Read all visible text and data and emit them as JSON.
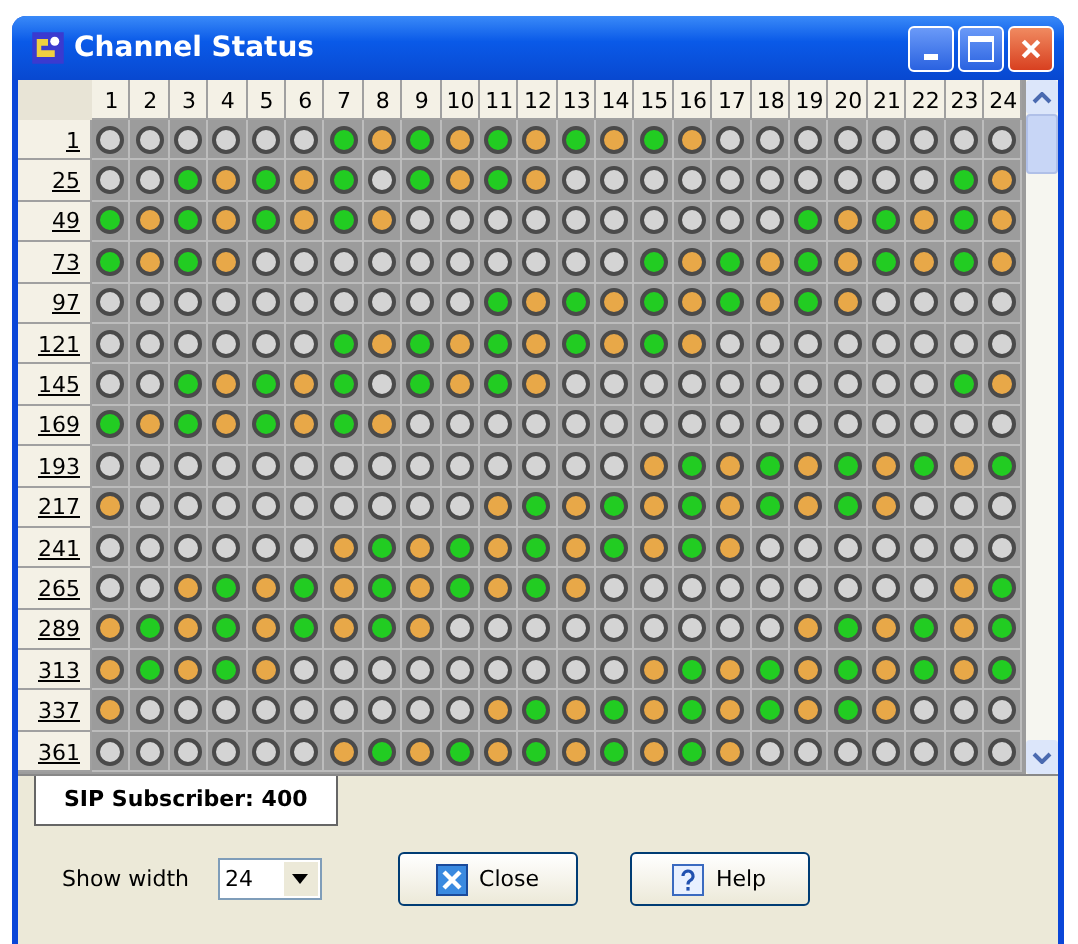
{
  "window": {
    "title": "Channel Status"
  },
  "columns": [
    "1",
    "2",
    "3",
    "4",
    "5",
    "6",
    "7",
    "8",
    "9",
    "10",
    "11",
    "12",
    "13",
    "14",
    "15",
    "16",
    "17",
    "18",
    "19",
    "20",
    "21",
    "22",
    "23",
    "24"
  ],
  "rows": [
    {
      "label": "1",
      "cells": [
        {
          "color": "#d4d4d4"
        },
        {
          "color": "#d4d4d4"
        },
        {
          "color": "#d4d4d4"
        },
        {
          "color": "#d4d4d4"
        },
        {
          "color": "#d4d4d4"
        },
        {
          "color": "#d4d4d4"
        },
        {
          "color": "#22cc22"
        },
        {
          "color": "#e8a848"
        },
        {
          "color": "#22cc22"
        },
        {
          "color": "#e8a848"
        },
        {
          "color": "#22cc22"
        },
        {
          "color": "#e8a848"
        },
        {
          "color": "#22cc22"
        },
        {
          "color": "#e8a848"
        },
        {
          "color": "#22cc22"
        },
        {
          "color": "#e8a848"
        },
        {
          "color": "#d4d4d4"
        },
        {
          "color": "#d4d4d4"
        },
        {
          "color": "#d4d4d4"
        },
        {
          "color": "#d4d4d4"
        },
        {
          "color": "#d4d4d4"
        },
        {
          "color": "#d4d4d4"
        },
        {
          "color": "#d4d4d4"
        },
        {
          "color": "#d4d4d4"
        }
      ]
    },
    {
      "label": "25",
      "cells": [
        {
          "color": "#d4d4d4"
        },
        {
          "color": "#d4d4d4"
        },
        {
          "color": "#22cc22"
        },
        {
          "color": "#e8a848"
        },
        {
          "color": "#22cc22"
        },
        {
          "color": "#e8a848"
        },
        {
          "color": "#22cc22"
        },
        {
          "color": "#d4d4d4"
        },
        {
          "color": "#22cc22"
        },
        {
          "color": "#e8a848"
        },
        {
          "color": "#22cc22"
        },
        {
          "color": "#e8a848"
        },
        {
          "color": "#d4d4d4"
        },
        {
          "color": "#d4d4d4"
        },
        {
          "color": "#d4d4d4"
        },
        {
          "color": "#d4d4d4"
        },
        {
          "color": "#d4d4d4"
        },
        {
          "color": "#d4d4d4"
        },
        {
          "color": "#d4d4d4"
        },
        {
          "color": "#d4d4d4"
        },
        {
          "color": "#d4d4d4"
        },
        {
          "color": "#d4d4d4"
        },
        {
          "color": "#22cc22"
        },
        {
          "color": "#e8a848"
        }
      ]
    },
    {
      "label": "49",
      "cells": [
        {
          "color": "#22cc22"
        },
        {
          "color": "#e8a848"
        },
        {
          "color": "#22cc22"
        },
        {
          "color": "#e8a848"
        },
        {
          "color": "#22cc22"
        },
        {
          "color": "#e8a848"
        },
        {
          "color": "#22cc22"
        },
        {
          "color": "#e8a848"
        },
        {
          "color": "#d4d4d4"
        },
        {
          "color": "#d4d4d4"
        },
        {
          "color": "#d4d4d4"
        },
        {
          "color": "#d4d4d4"
        },
        {
          "color": "#d4d4d4"
        },
        {
          "color": "#d4d4d4"
        },
        {
          "color": "#d4d4d4"
        },
        {
          "color": "#d4d4d4"
        },
        {
          "color": "#d4d4d4"
        },
        {
          "color": "#d4d4d4"
        },
        {
          "color": "#22cc22"
        },
        {
          "color": "#e8a848"
        },
        {
          "color": "#22cc22"
        },
        {
          "color": "#e8a848"
        },
        {
          "color": "#22cc22"
        },
        {
          "color": "#e8a848"
        }
      ]
    },
    {
      "label": "73",
      "cells": [
        {
          "color": "#22cc22"
        },
        {
          "color": "#e8a848"
        },
        {
          "color": "#22cc22"
        },
        {
          "color": "#e8a848"
        },
        {
          "color": "#d4d4d4"
        },
        {
          "color": "#d4d4d4"
        },
        {
          "color": "#d4d4d4"
        },
        {
          "color": "#d4d4d4"
        },
        {
          "color": "#d4d4d4"
        },
        {
          "color": "#d4d4d4"
        },
        {
          "color": "#d4d4d4"
        },
        {
          "color": "#d4d4d4"
        },
        {
          "color": "#d4d4d4"
        },
        {
          "color": "#d4d4d4"
        },
        {
          "color": "#22cc22"
        },
        {
          "color": "#e8a848"
        },
        {
          "color": "#22cc22"
        },
        {
          "color": "#e8a848"
        },
        {
          "color": "#22cc22"
        },
        {
          "color": "#e8a848"
        },
        {
          "color": "#22cc22"
        },
        {
          "color": "#e8a848"
        },
        {
          "color": "#22cc22"
        },
        {
          "color": "#e8a848"
        }
      ]
    },
    {
      "label": "97",
      "cells": [
        {
          "color": "#d4d4d4"
        },
        {
          "color": "#d4d4d4"
        },
        {
          "color": "#d4d4d4"
        },
        {
          "color": "#d4d4d4"
        },
        {
          "color": "#d4d4d4"
        },
        {
          "color": "#d4d4d4"
        },
        {
          "color": "#d4d4d4"
        },
        {
          "color": "#d4d4d4"
        },
        {
          "color": "#d4d4d4"
        },
        {
          "color": "#d4d4d4"
        },
        {
          "color": "#22cc22"
        },
        {
          "color": "#e8a848"
        },
        {
          "color": "#22cc22"
        },
        {
          "color": "#e8a848"
        },
        {
          "color": "#22cc22"
        },
        {
          "color": "#e8a848"
        },
        {
          "color": "#22cc22"
        },
        {
          "color": "#e8a848"
        },
        {
          "color": "#22cc22"
        },
        {
          "color": "#e8a848"
        },
        {
          "color": "#d4d4d4"
        },
        {
          "color": "#d4d4d4"
        },
        {
          "color": "#d4d4d4"
        },
        {
          "color": "#d4d4d4"
        }
      ]
    },
    {
      "label": "121",
      "cells": [
        {
          "color": "#d4d4d4"
        },
        {
          "color": "#d4d4d4"
        },
        {
          "color": "#d4d4d4"
        },
        {
          "color": "#d4d4d4"
        },
        {
          "color": "#d4d4d4"
        },
        {
          "color": "#d4d4d4"
        },
        {
          "color": "#22cc22"
        },
        {
          "color": "#e8a848"
        },
        {
          "color": "#22cc22"
        },
        {
          "color": "#e8a848"
        },
        {
          "color": "#22cc22"
        },
        {
          "color": "#e8a848"
        },
        {
          "color": "#22cc22"
        },
        {
          "color": "#e8a848"
        },
        {
          "color": "#22cc22"
        },
        {
          "color": "#e8a848"
        },
        {
          "color": "#d4d4d4"
        },
        {
          "color": "#d4d4d4"
        },
        {
          "color": "#d4d4d4"
        },
        {
          "color": "#d4d4d4"
        },
        {
          "color": "#d4d4d4"
        },
        {
          "color": "#d4d4d4"
        },
        {
          "color": "#d4d4d4"
        },
        {
          "color": "#d4d4d4"
        }
      ]
    },
    {
      "label": "145",
      "cells": [
        {
          "color": "#d4d4d4"
        },
        {
          "color": "#d4d4d4"
        },
        {
          "color": "#22cc22"
        },
        {
          "color": "#e8a848"
        },
        {
          "color": "#22cc22"
        },
        {
          "color": "#e8a848"
        },
        {
          "color": "#22cc22"
        },
        {
          "color": "#d4d4d4"
        },
        {
          "color": "#22cc22"
        },
        {
          "color": "#e8a848"
        },
        {
          "color": "#22cc22"
        },
        {
          "color": "#e8a848"
        },
        {
          "color": "#d4d4d4"
        },
        {
          "color": "#d4d4d4"
        },
        {
          "color": "#d4d4d4"
        },
        {
          "color": "#d4d4d4"
        },
        {
          "color": "#d4d4d4"
        },
        {
          "color": "#d4d4d4"
        },
        {
          "color": "#d4d4d4"
        },
        {
          "color": "#d4d4d4"
        },
        {
          "color": "#d4d4d4"
        },
        {
          "color": "#d4d4d4"
        },
        {
          "color": "#22cc22"
        },
        {
          "color": "#e8a848"
        }
      ]
    },
    {
      "label": "169",
      "cells": [
        {
          "color": "#22cc22"
        },
        {
          "color": "#e8a848"
        },
        {
          "color": "#22cc22"
        },
        {
          "color": "#e8a848"
        },
        {
          "color": "#22cc22"
        },
        {
          "color": "#e8a848"
        },
        {
          "color": "#22cc22"
        },
        {
          "color": "#e8a848"
        },
        {
          "color": "#d4d4d4"
        },
        {
          "color": "#d4d4d4"
        },
        {
          "color": "#d4d4d4"
        },
        {
          "color": "#d4d4d4"
        },
        {
          "color": "#d4d4d4"
        },
        {
          "color": "#d4d4d4"
        },
        {
          "color": "#d4d4d4"
        },
        {
          "color": "#d4d4d4"
        },
        {
          "color": "#d4d4d4"
        },
        {
          "color": "#d4d4d4"
        },
        {
          "color": "#d4d4d4"
        },
        {
          "color": "#d4d4d4"
        },
        {
          "color": "#d4d4d4"
        },
        {
          "color": "#d4d4d4"
        },
        {
          "color": "#d4d4d4"
        },
        {
          "color": "#d4d4d4"
        }
      ]
    },
    {
      "label": "193",
      "cells": [
        {
          "color": "#d4d4d4"
        },
        {
          "color": "#d4d4d4"
        },
        {
          "color": "#d4d4d4"
        },
        {
          "color": "#d4d4d4"
        },
        {
          "color": "#d4d4d4"
        },
        {
          "color": "#d4d4d4"
        },
        {
          "color": "#d4d4d4"
        },
        {
          "color": "#d4d4d4"
        },
        {
          "color": "#d4d4d4"
        },
        {
          "color": "#d4d4d4"
        },
        {
          "color": "#d4d4d4"
        },
        {
          "color": "#d4d4d4"
        },
        {
          "color": "#d4d4d4"
        },
        {
          "color": "#d4d4d4"
        },
        {
          "color": "#e8a848"
        },
        {
          "color": "#22cc22"
        },
        {
          "color": "#e8a848"
        },
        {
          "color": "#22cc22"
        },
        {
          "color": "#e8a848"
        },
        {
          "color": "#22cc22"
        },
        {
          "color": "#e8a848"
        },
        {
          "color": "#22cc22"
        },
        {
          "color": "#e8a848"
        },
        {
          "color": "#22cc22"
        }
      ]
    },
    {
      "label": "217",
      "cells": [
        {
          "color": "#e8a848"
        },
        {
          "color": "#d4d4d4"
        },
        {
          "color": "#d4d4d4"
        },
        {
          "color": "#d4d4d4"
        },
        {
          "color": "#d4d4d4"
        },
        {
          "color": "#d4d4d4"
        },
        {
          "color": "#d4d4d4"
        },
        {
          "color": "#d4d4d4"
        },
        {
          "color": "#d4d4d4"
        },
        {
          "color": "#d4d4d4"
        },
        {
          "color": "#e8a848"
        },
        {
          "color": "#22cc22"
        },
        {
          "color": "#e8a848"
        },
        {
          "color": "#22cc22"
        },
        {
          "color": "#e8a848"
        },
        {
          "color": "#22cc22"
        },
        {
          "color": "#e8a848"
        },
        {
          "color": "#22cc22"
        },
        {
          "color": "#e8a848"
        },
        {
          "color": "#22cc22"
        },
        {
          "color": "#e8a848"
        },
        {
          "color": "#d4d4d4"
        },
        {
          "color": "#d4d4d4"
        },
        {
          "color": "#d4d4d4"
        }
      ]
    },
    {
      "label": "241",
      "cells": [
        {
          "color": "#d4d4d4"
        },
        {
          "color": "#d4d4d4"
        },
        {
          "color": "#d4d4d4"
        },
        {
          "color": "#d4d4d4"
        },
        {
          "color": "#d4d4d4"
        },
        {
          "color": "#d4d4d4"
        },
        {
          "color": "#e8a848"
        },
        {
          "color": "#22cc22"
        },
        {
          "color": "#e8a848"
        },
        {
          "color": "#22cc22"
        },
        {
          "color": "#e8a848"
        },
        {
          "color": "#22cc22"
        },
        {
          "color": "#e8a848"
        },
        {
          "color": "#22cc22"
        },
        {
          "color": "#e8a848"
        },
        {
          "color": "#22cc22"
        },
        {
          "color": "#e8a848"
        },
        {
          "color": "#d4d4d4"
        },
        {
          "color": "#d4d4d4"
        },
        {
          "color": "#d4d4d4"
        },
        {
          "color": "#d4d4d4"
        },
        {
          "color": "#d4d4d4"
        },
        {
          "color": "#d4d4d4"
        },
        {
          "color": "#d4d4d4"
        }
      ]
    },
    {
      "label": "265",
      "cells": [
        {
          "color": "#d4d4d4"
        },
        {
          "color": "#d4d4d4"
        },
        {
          "color": "#e8a848"
        },
        {
          "color": "#22cc22"
        },
        {
          "color": "#e8a848"
        },
        {
          "color": "#22cc22"
        },
        {
          "color": "#e8a848"
        },
        {
          "color": "#22cc22"
        },
        {
          "color": "#e8a848"
        },
        {
          "color": "#22cc22"
        },
        {
          "color": "#e8a848"
        },
        {
          "color": "#22cc22"
        },
        {
          "color": "#e8a848"
        },
        {
          "color": "#d4d4d4"
        },
        {
          "color": "#d4d4d4"
        },
        {
          "color": "#d4d4d4"
        },
        {
          "color": "#d4d4d4"
        },
        {
          "color": "#d4d4d4"
        },
        {
          "color": "#d4d4d4"
        },
        {
          "color": "#d4d4d4"
        },
        {
          "color": "#d4d4d4"
        },
        {
          "color": "#d4d4d4"
        },
        {
          "color": "#e8a848"
        },
        {
          "color": "#22cc22"
        }
      ]
    },
    {
      "label": "289",
      "cells": [
        {
          "color": "#e8a848"
        },
        {
          "color": "#22cc22"
        },
        {
          "color": "#e8a848"
        },
        {
          "color": "#22cc22"
        },
        {
          "color": "#e8a848"
        },
        {
          "color": "#22cc22"
        },
        {
          "color": "#e8a848"
        },
        {
          "color": "#22cc22"
        },
        {
          "color": "#e8a848"
        },
        {
          "color": "#d4d4d4"
        },
        {
          "color": "#d4d4d4"
        },
        {
          "color": "#d4d4d4"
        },
        {
          "color": "#d4d4d4"
        },
        {
          "color": "#d4d4d4"
        },
        {
          "color": "#d4d4d4"
        },
        {
          "color": "#d4d4d4"
        },
        {
          "color": "#d4d4d4"
        },
        {
          "color": "#d4d4d4"
        },
        {
          "color": "#e8a848"
        },
        {
          "color": "#22cc22"
        },
        {
          "color": "#e8a848"
        },
        {
          "color": "#22cc22"
        },
        {
          "color": "#e8a848"
        },
        {
          "color": "#22cc22"
        }
      ]
    },
    {
      "label": "313",
      "cells": [
        {
          "color": "#e8a848"
        },
        {
          "color": "#22cc22"
        },
        {
          "color": "#e8a848"
        },
        {
          "color": "#22cc22"
        },
        {
          "color": "#e8a848"
        },
        {
          "color": "#d4d4d4"
        },
        {
          "color": "#d4d4d4"
        },
        {
          "color": "#d4d4d4"
        },
        {
          "color": "#d4d4d4"
        },
        {
          "color": "#d4d4d4"
        },
        {
          "color": "#d4d4d4"
        },
        {
          "color": "#d4d4d4"
        },
        {
          "color": "#d4d4d4"
        },
        {
          "color": "#d4d4d4"
        },
        {
          "color": "#e8a848"
        },
        {
          "color": "#22cc22"
        },
        {
          "color": "#e8a848"
        },
        {
          "color": "#22cc22"
        },
        {
          "color": "#e8a848"
        },
        {
          "color": "#22cc22"
        },
        {
          "color": "#e8a848"
        },
        {
          "color": "#22cc22"
        },
        {
          "color": "#e8a848"
        },
        {
          "color": "#22cc22"
        }
      ]
    },
    {
      "label": "337",
      "cells": [
        {
          "color": "#e8a848"
        },
        {
          "color": "#d4d4d4"
        },
        {
          "color": "#d4d4d4"
        },
        {
          "color": "#d4d4d4"
        },
        {
          "color": "#d4d4d4"
        },
        {
          "color": "#d4d4d4"
        },
        {
          "color": "#d4d4d4"
        },
        {
          "color": "#d4d4d4"
        },
        {
          "color": "#d4d4d4"
        },
        {
          "color": "#d4d4d4"
        },
        {
          "color": "#e8a848"
        },
        {
          "color": "#22cc22"
        },
        {
          "color": "#e8a848"
        },
        {
          "color": "#22cc22"
        },
        {
          "color": "#e8a848"
        },
        {
          "color": "#22cc22"
        },
        {
          "color": "#e8a848"
        },
        {
          "color": "#22cc22"
        },
        {
          "color": "#e8a848"
        },
        {
          "color": "#22cc22"
        },
        {
          "color": "#e8a848"
        },
        {
          "color": "#d4d4d4"
        },
        {
          "color": "#d4d4d4"
        },
        {
          "color": "#d4d4d4"
        }
      ]
    },
    {
      "label": "361",
      "cells": [
        {
          "color": "#d4d4d4"
        },
        {
          "color": "#d4d4d4"
        },
        {
          "color": "#d4d4d4"
        },
        {
          "color": "#d4d4d4"
        },
        {
          "color": "#d4d4d4"
        },
        {
          "color": "#d4d4d4"
        },
        {
          "color": "#e8a848"
        },
        {
          "color": "#22cc22"
        },
        {
          "color": "#e8a848"
        },
        {
          "color": "#22cc22"
        },
        {
          "color": "#e8a848"
        },
        {
          "color": "#22cc22"
        },
        {
          "color": "#e8a848"
        },
        {
          "color": "#22cc22"
        },
        {
          "color": "#e8a848"
        },
        {
          "color": "#22cc22"
        },
        {
          "color": "#e8a848"
        },
        {
          "color": "#d4d4d4"
        },
        {
          "color": "#d4d4d4"
        },
        {
          "color": "#d4d4d4"
        },
        {
          "color": "#d4d4d4"
        },
        {
          "color": "#d4d4d4"
        },
        {
          "color": "#d4d4d4"
        },
        {
          "color": "#d4d4d4"
        }
      ]
    }
  ],
  "tab": {
    "label": "SIP Subscriber: 400",
    "selected": true
  },
  "show_width": {
    "label": "Show width",
    "value": "24"
  },
  "buttons": [
    {
      "kind": "close",
      "label": "Close"
    },
    {
      "kind": "help",
      "label": "Help"
    }
  ]
}
